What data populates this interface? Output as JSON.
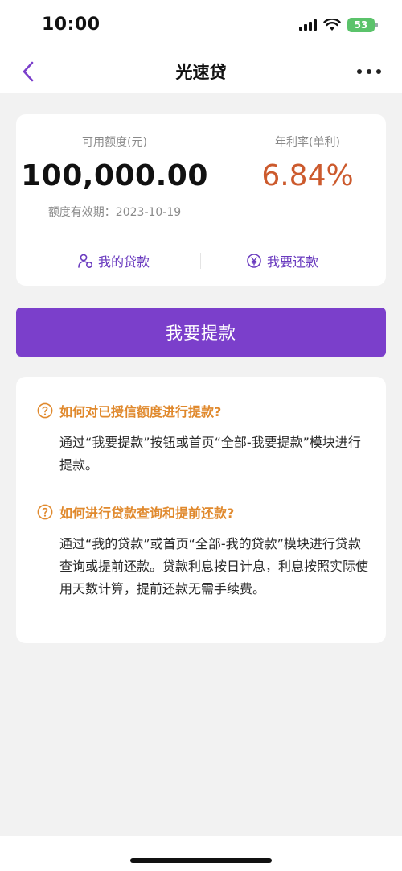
{
  "status_bar": {
    "time": "10:00",
    "battery": "53"
  },
  "nav": {
    "title": "光速贷"
  },
  "loan_card": {
    "available_label": "可用额度(元)",
    "available_amount": "100,000.00",
    "rate_label": "年利率(单利)",
    "rate_value": "6.84%",
    "validity": "额度有效期：2023-10-19",
    "my_loans_label": "我的贷款",
    "repay_label": "我要还款"
  },
  "withdraw_button": "我要提款",
  "faq": [
    {
      "question": "如何对已授信额度进行提款?",
      "answer": "通过“我要提款”按钮或首页“全部-我要提款”模块进行提款。"
    },
    {
      "question": "如何进行贷款查询和提前还款?",
      "answer": "通过“我的贷款”或首页“全部-我的贷款”模块进行贷款查询或提前还款。贷款利息按日计息，利息按照实际使用天数计算，提前还款无需手续费。"
    }
  ],
  "colors": {
    "accent": "#7b3fcb",
    "rate": "#cc5a2d",
    "faq_question": "#e0892d"
  }
}
